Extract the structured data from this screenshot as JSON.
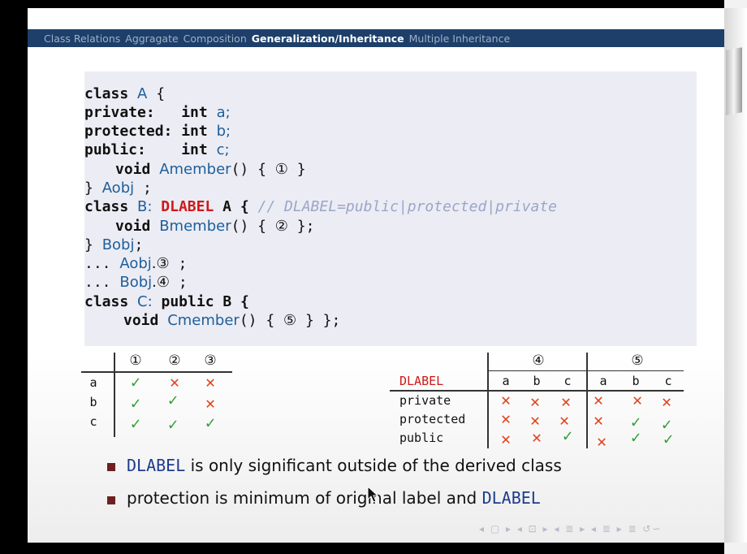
{
  "nav": {
    "tabs": [
      "Class Relations",
      "Aggragate",
      "Composition",
      "Generalization/Inheritance",
      "Multiple Inheritance"
    ],
    "active_index": 3
  },
  "code": {
    "l1_kw": "class",
    "l1_id": "A",
    "l1_tail": " {",
    "l2": "private:",
    "l2_type": "int",
    "l2_var": "a;",
    "l3": "protected:",
    "l3_type": "int",
    "l3_var": "b;",
    "l4": "public:",
    "l4_type": "int",
    "l4_var": "c;",
    "l5_type": "void",
    "l5_id": "Amember",
    "l5_tail": "() { ",
    "l5_mark": "①",
    "l5_end": " }",
    "l6_a": "} ",
    "l6_id": "Aobj",
    "l6_b": " ;",
    "l7_kw": "class",
    "l7_id": "B:",
    "l7_red": "DLABEL",
    "l7_b": " A {",
    "l7_comment": "// DLABEL=public|protected|private",
    "l8_type": "void",
    "l8_id": "Bmember",
    "l8_tail": "() { ",
    "l8_mark": "②",
    "l8_end": " };",
    "l9_a": "} ",
    "l9_id": "Bobj",
    "l9_b": ";",
    "l10_a": "... ",
    "l10_id": "Aobj",
    "l10_mark": ".③",
    "l10_b": " ;",
    "l11_a": "... ",
    "l11_id": "Bobj",
    "l11_mark": ".④",
    "l11_b": " ;",
    "l12_kw": "class",
    "l12_id": "C:",
    "l12_b": " public B {",
    "l13_type": "void",
    "l13_id": "Cmember",
    "l13_tail": "() { ",
    "l13_mark": "⑤",
    "l13_end": " } };"
  },
  "left_table": {
    "headers": [
      "①",
      "②",
      "③"
    ],
    "rows": [
      {
        "label": "a",
        "cells": [
          "✓",
          "✕",
          "✕"
        ],
        "kinds": [
          "ok",
          "no",
          "no"
        ]
      },
      {
        "label": "b",
        "cells": [
          "✓",
          "✓",
          "✕"
        ],
        "kinds": [
          "ok",
          "ok",
          "no"
        ]
      },
      {
        "label": "c",
        "cells": [
          "✓",
          "✓",
          "✓"
        ],
        "kinds": [
          "ok",
          "ok",
          "ok"
        ]
      }
    ]
  },
  "right_table": {
    "group4": "④",
    "group5": "⑤",
    "label_header": "DLABEL",
    "sub": [
      "a",
      "b",
      "c",
      "a",
      "b",
      "c"
    ],
    "rows": [
      {
        "label": "private",
        "cells": [
          "✕",
          "✕",
          "✕",
          "✕",
          "✕",
          "✕"
        ],
        "kinds": [
          "no",
          "no",
          "no",
          "no",
          "no",
          "no"
        ]
      },
      {
        "label": "protected",
        "cells": [
          "✕",
          "✕",
          "✕",
          "✕",
          "✓",
          "✓"
        ],
        "kinds": [
          "no",
          "no",
          "no",
          "no",
          "ok",
          "ok"
        ]
      },
      {
        "label": "public",
        "cells": [
          "✕",
          "✕",
          "✓",
          "✕",
          "✓",
          "✓"
        ],
        "kinds": [
          "no",
          "no",
          "ok",
          "no",
          "ok",
          "ok"
        ]
      }
    ]
  },
  "bullets": [
    {
      "code": "DLABEL",
      "text": " is only significant outside of the derived class"
    },
    {
      "text_a": "protection is minimum of original label and ",
      "code": "DLABEL"
    }
  ],
  "navicons": "◂ ▢ ▸ ◂ ⊡ ▸ ◂ ≣ ▸ ◂ ≣ ▸   ≣   ↺∽",
  "colors": {
    "topbar": "#1d3f6a",
    "check": "#2f9e2f",
    "cross": "#e0431e",
    "dlabel_red": "#d01818",
    "bullet": "#6e1f1f"
  }
}
